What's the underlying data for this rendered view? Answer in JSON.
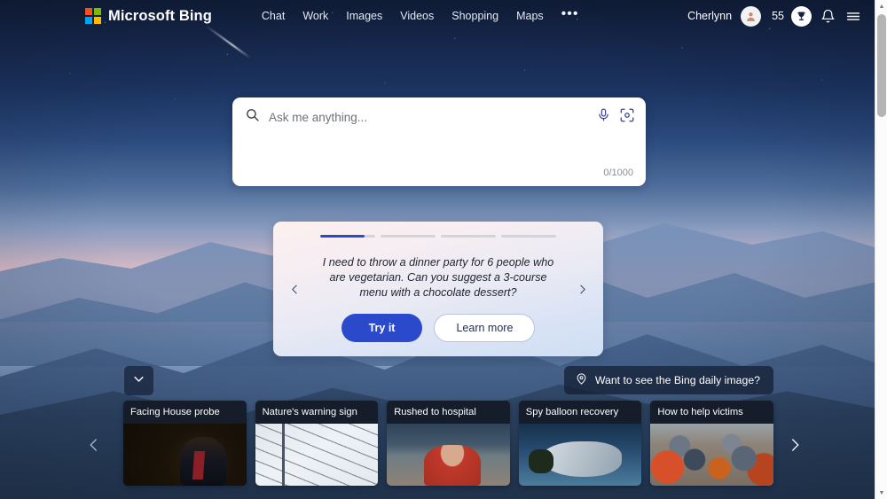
{
  "header": {
    "brand": "Microsoft Bing",
    "logo_colors": {
      "top_left": "#f25022",
      "top_right": "#7fba00",
      "bottom_left": "#00a4ef",
      "bottom_right": "#ffb900"
    },
    "nav": [
      {
        "label": "Chat",
        "name": "nav-chat"
      },
      {
        "label": "Work",
        "name": "nav-work"
      },
      {
        "label": "Images",
        "name": "nav-images"
      },
      {
        "label": "Videos",
        "name": "nav-videos"
      },
      {
        "label": "Shopping",
        "name": "nav-shopping"
      },
      {
        "label": "Maps",
        "name": "nav-maps"
      }
    ],
    "more_label": "•••",
    "user_name": "Cherlynn",
    "reward_points": "55",
    "icons": [
      "account-avatar",
      "rewards-trophy-icon",
      "notification-bell-icon",
      "hamburger-menu-icon"
    ]
  },
  "search": {
    "placeholder": "Ask me anything...",
    "value": "",
    "char_count": "0/1000",
    "icons": [
      "search-icon",
      "microphone-icon",
      "visual-search-icon"
    ]
  },
  "promo": {
    "progress": {
      "segments": 4,
      "active_index": 0,
      "active_fill_percent": 80
    },
    "prompt_text": "I need to throw a dinner party for 6 people who are vegetarian. Can you suggest a 3-course menu with a chocolate dessert?",
    "primary_button": "Try it",
    "secondary_button": "Learn more",
    "prev_label": "‹",
    "next_label": "›",
    "accent_color": "#2b4acb"
  },
  "daily_image_pill": {
    "label": "Want to see the Bing daily image?",
    "icon": "location-pin-icon"
  },
  "expand_button": {
    "icon": "chevron-down-icon"
  },
  "news": {
    "prev_label": "‹",
    "next_label": "›",
    "cards": [
      {
        "title": "Facing House probe",
        "thumb": "th-hearing"
      },
      {
        "title": "Nature's warning sign",
        "thumb": "th-birds"
      },
      {
        "title": "Rushed to hospital",
        "thumb": "th-stadium"
      },
      {
        "title": "Spy balloon recovery",
        "thumb": "th-balloon"
      },
      {
        "title": "How to help victims",
        "thumb": "th-crowd"
      }
    ]
  }
}
